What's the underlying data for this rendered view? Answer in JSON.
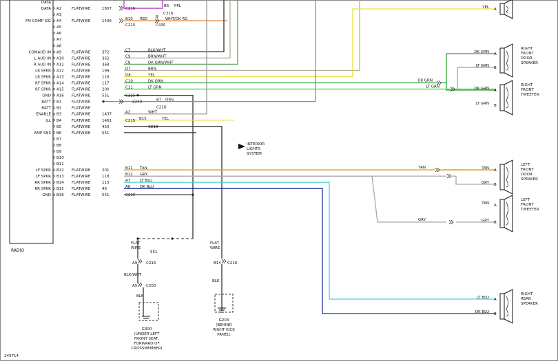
{
  "radio": {
    "label": "RADIO",
    "pins": [
      {
        "name": "DATA",
        "pin": ""
      },
      {
        "name": "DATA",
        "pin": "A2"
      },
      {
        "name": "",
        "pin": "A3"
      },
      {
        "name": "FM COMP SIG",
        "pin": "A4"
      },
      {
        "name": "",
        "pin": "A5"
      },
      {
        "name": "",
        "pin": "A6"
      },
      {
        "name": "",
        "pin": "A7"
      },
      {
        "name": "",
        "pin": "A8"
      },
      {
        "name": "COMAUD IN",
        "pin": "A9"
      },
      {
        "name": "L AUD IN",
        "pin": "A10"
      },
      {
        "name": "R AUD IN",
        "pin": "A11"
      },
      {
        "name": "LR SPKR",
        "pin": "A12"
      },
      {
        "name": "LR SPKR",
        "pin": "A13"
      },
      {
        "name": "RF SPKR",
        "pin": "A14"
      },
      {
        "name": "RF SPKR",
        "pin": "A15"
      },
      {
        "name": "GND",
        "pin": "A16"
      },
      {
        "name": "BATT",
        "pin": "B1"
      },
      {
        "name": "BATT",
        "pin": "B2"
      },
      {
        "name": "ENABLE",
        "pin": "B3"
      },
      {
        "name": "ILL",
        "pin": "B4"
      },
      {
        "name": "",
        "pin": "B5"
      },
      {
        "name": "AMP SNS",
        "pin": "B6"
      },
      {
        "name": "",
        "pin": "B7"
      },
      {
        "name": "",
        "pin": "B8"
      },
      {
        "name": "",
        "pin": "B9"
      },
      {
        "name": "",
        "pin": "B10"
      },
      {
        "name": "",
        "pin": "B11"
      },
      {
        "name": "LF SPKR",
        "pin": "B12"
      },
      {
        "name": "LF SPKR",
        "pin": "B13"
      },
      {
        "name": "RR SPKR",
        "pin": "B14"
      },
      {
        "name": "RR SPKR",
        "pin": "B15"
      },
      {
        "name": "GND",
        "pin": "B16"
      }
    ]
  },
  "circuits": [
    {
      "label": "",
      "num": ""
    },
    {
      "label": "FLATWIRE",
      "num": "1807"
    },
    {
      "label": "",
      "num": ""
    },
    {
      "label": "FLATWIRE",
      "num": "1436"
    },
    {
      "label": "",
      "num": ""
    },
    {
      "label": "",
      "num": ""
    },
    {
      "label": "",
      "num": ""
    },
    {
      "label": "",
      "num": ""
    },
    {
      "label": "FLATWIRE",
      "num": "372"
    },
    {
      "label": "FLATWIRE",
      "num": "362"
    },
    {
      "label": "FLATWIRE",
      "num": "368"
    },
    {
      "label": "FLATWIRE",
      "num": "199"
    },
    {
      "label": "FLATWIRE",
      "num": "116"
    },
    {
      "label": "FLATWIRE",
      "num": "117"
    },
    {
      "label": "FLATWIRE",
      "num": "200"
    },
    {
      "label": "FLATWIRE",
      "num": "551"
    },
    {
      "label": "FLATWIRE",
      "num": ""
    },
    {
      "label": "FLATWIRE",
      "num": ""
    },
    {
      "label": "FLATWIRE",
      "num": "1437"
    },
    {
      "label": "FLATWIRE",
      "num": "1461"
    },
    {
      "label": "FLATWIRE",
      "num": "450"
    },
    {
      "label": "FLATWIRE",
      "num": "551"
    },
    {
      "label": "",
      "num": ""
    },
    {
      "label": "",
      "num": ""
    },
    {
      "label": "",
      "num": ""
    },
    {
      "label": "",
      "num": ""
    },
    {
      "label": "",
      "num": ""
    },
    {
      "label": "FLATWIRE",
      "num": "201"
    },
    {
      "label": "FLATWIRE",
      "num": "118"
    },
    {
      "label": "FLATWIRE",
      "num": "115"
    },
    {
      "label": "FLATWIRE",
      "num": "46"
    },
    {
      "label": "FLATWIRE",
      "num": "551"
    }
  ],
  "connector_labels": {
    "a2_pin": "B6",
    "a2_conn": "C216",
    "a2_color": "PPL",
    "a4_pin": "B10",
    "a4_conn": "C215",
    "a4_color": "RED",
    "a4_pin2": "B",
    "a4_conn2": "C430",
    "a4_color2": "WHT/DK RG",
    "a9_pin": "C7",
    "a9_color": "BLK/WHT",
    "a10_pin": "C9",
    "a10_color": "BRN/WHT",
    "a11_pin": "C8",
    "a11_color": "DK GRN/WHT",
    "a12_pin": "D7",
    "a12_color": "BRN",
    "a13_pin": "D8",
    "a13_color": "YEL",
    "a14_pin": "C10",
    "a14_color": "DK GRN",
    "a15_pin": "C11",
    "a15_color": "LT GRN",
    "a16_conn": "C215",
    "b1_circuit": "Z240",
    "b1_pin": "B7",
    "b1_color": "ORG",
    "b1_conn": "C216",
    "b3_pin": "A2",
    "b3_color": "WHT",
    "b4_conn": "C215",
    "b4_pin": "B15",
    "b4_color": "YEL",
    "b4_conn2": "C216",
    "b12_pin": "B11",
    "b12_color": "TAN",
    "b13_pin": "B12",
    "b13_color": "GRY",
    "b14_pin": "A7",
    "b14_color": "LT BLU",
    "b15_pin": "A8",
    "b15_color": "DK BLU",
    "b16_conn": "C215"
  },
  "interior_lights": "INTERIOR\nLIGHTS\nSYSTEM",
  "speakers": [
    {
      "name": "",
      "pinA": "A",
      "colorA": "YEL",
      "pinB": "",
      "colorB": ""
    },
    {
      "name": "RIGHT\nFRONT\nDOOR\nSPEAKER",
      "pinA": "A",
      "colorA": "DK GRN",
      "pinB": "B",
      "colorB": "LT GRN"
    },
    {
      "name": "RIGHT\nFRONT\nTWEETER",
      "pinA": "A",
      "colorA": "DK GRN",
      "pinB": "B",
      "colorB": "LT GRN"
    },
    {
      "name": "LEFT\nFRONT\nDOOR\nSPEAKER",
      "pinA": "A",
      "colorA": "TAN",
      "pinB": "B",
      "colorB": "GRY"
    },
    {
      "name": "LEFT\nFRONT\nTWEETER",
      "pinA": "A",
      "colorA": "TAN",
      "pinB": "B",
      "colorB": "GRY"
    },
    {
      "name": "RIGHT\nREAR\nSPEAKER",
      "pinA": "A",
      "colorA": "LT BLU",
      "pinB": "B",
      "colorB": "DK BLU"
    }
  ],
  "splice_labels": {
    "tweeter_dkgrn": "DK GRN",
    "tweeter_ltgrn": "LT GRN",
    "lf_tan": "TAN",
    "lf_gry": "GRY",
    "lf_gry2": "GRY"
  },
  "bottom": {
    "left_flat": "FLAT\nWIRE",
    "left_num": "551",
    "left_pin": "A9",
    "left_conn": "C216",
    "left_color": "BLK/WHT",
    "left_pin2": "A5",
    "left_conn2": "C200",
    "left_blk": "BLK",
    "g300": "G300\n(UNDER LEFT\nFRONT SEAT,\nFORWARD OF\nCROSSMEMBER)",
    "right_flat": "FLAT\nWIRE",
    "right_pin": "B14",
    "right_conn": "C216",
    "right_blk": "BLK",
    "g203": "G203\n(BEHIND\nRIGHT KICK\nPANEL)"
  },
  "diagram_id": "145714",
  "colors": {
    "purple": "#b040c0",
    "orange": "#e07820",
    "yellow": "#e8e040",
    "dk_green": "#30a030",
    "lt_green": "#40e040",
    "tan": "#e0a020",
    "gray": "#a8a8a8",
    "lt_blue": "#40d0e0",
    "dk_blue": "#203090",
    "black": "#404040",
    "wht_brn": "#c0b0a0"
  }
}
